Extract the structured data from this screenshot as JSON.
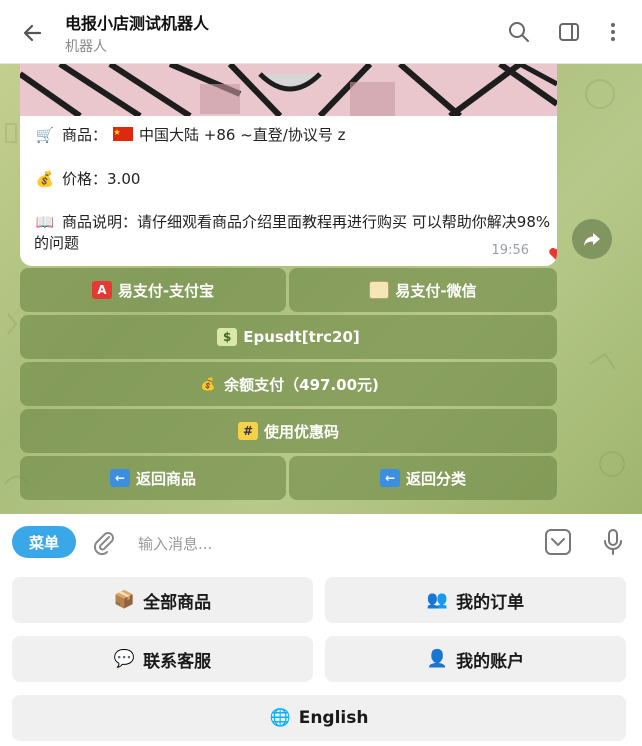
{
  "header": {
    "title": "电报小店测试机器人",
    "subtitle": "机器人"
  },
  "message": {
    "product_label": "商品：",
    "product_value": "中国大陆 +86 ~直登/协议号 z",
    "price_label": "价格：",
    "price_value": "3.00",
    "desc_label": "商品说明：",
    "desc_value": "请仔细观看商品介绍里面教程再进行购买 可以帮助你解决98%的问题",
    "time": "19:56",
    "reaction": "❤️"
  },
  "inline_keyboard": {
    "alipay": "易支付-支付宝",
    "wechat": "易支付-微信",
    "epusdt": "Epusdt[trc20]",
    "balance": "余额支付（497.00元)",
    "coupon": "使用优惠码",
    "back_product": "返回商品",
    "back_category": "返回分类"
  },
  "input": {
    "menu_label": "菜单",
    "placeholder": "输入消息..."
  },
  "reply_keyboard": {
    "all_products": "全部商品",
    "my_orders": "我的订单",
    "contact": "联系客服",
    "my_account": "我的账户",
    "english": "English"
  },
  "colors": {
    "accent": "#3aa7e8",
    "inline_button": "#6e8746",
    "chat_bg": "#b5c68a"
  }
}
